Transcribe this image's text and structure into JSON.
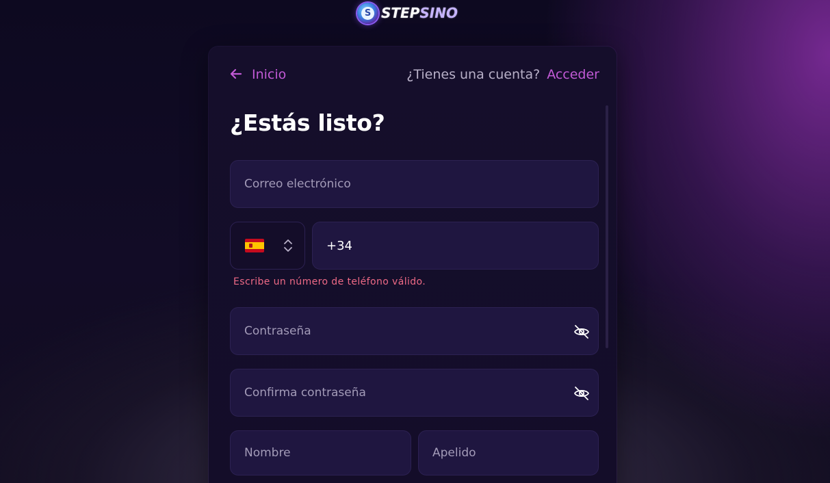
{
  "brand": {
    "logo_letter": "S",
    "name_part1": "STEP",
    "name_part2": "SINO"
  },
  "nav": {
    "back_label": "Inicio",
    "account_question": "¿Tienes una cuenta?",
    "login_link": "Acceder"
  },
  "form": {
    "heading": "¿Estás listo?",
    "email": {
      "placeholder": "Correo electrónico",
      "value": ""
    },
    "country": {
      "flag": "spain-flag",
      "selected": "ES"
    },
    "phone": {
      "value": "+34"
    },
    "phone_error": "Escribe un número de teléfono válido.",
    "password": {
      "placeholder": "Contraseña",
      "value": ""
    },
    "confirm_password": {
      "placeholder": "Confirma contraseña",
      "value": ""
    },
    "first_name": {
      "placeholder": "Nombre",
      "value": ""
    },
    "last_name": {
      "placeholder": "Apelido",
      "value": ""
    }
  },
  "colors": {
    "accent": "#c25ad6",
    "error": "#ee6a86",
    "field_bg": "#1f1640",
    "card_bg": "#150e2b"
  },
  "icons": [
    "back-arrow-icon",
    "chevron-updown-icon",
    "eye-off-icon"
  ]
}
